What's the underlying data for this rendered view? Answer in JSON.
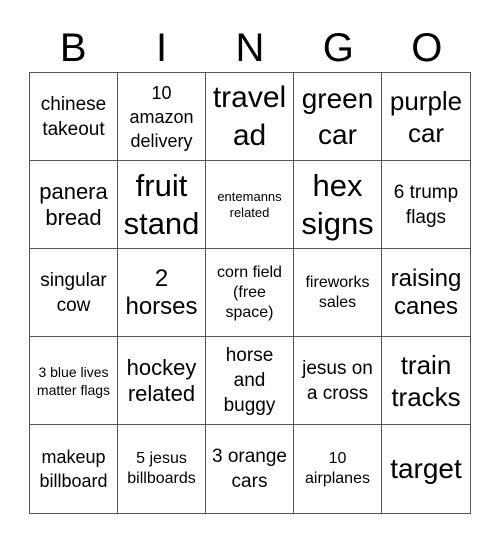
{
  "header": {
    "letters": [
      "B",
      "I",
      "N",
      "G",
      "O"
    ]
  },
  "board": {
    "rows": [
      [
        "chinese takeout",
        "10 amazon delivery",
        "travel ad",
        "green car",
        "purple car"
      ],
      [
        "panera bread",
        "fruit stand",
        "entemanns related",
        "hex signs",
        "6 trump flags"
      ],
      [
        "singular cow",
        "2 horses",
        "corn field (free space)",
        "fireworks sales",
        "raising canes"
      ],
      [
        "3 blue lives matter flags",
        "hockey related",
        "horse and buggy",
        "jesus on a cross",
        "train tracks"
      ],
      [
        "makeup billboard",
        "5 jesus billboards",
        "3 orange cars",
        "10 airplanes",
        "target"
      ]
    ],
    "free_space": "corn field (free space)"
  }
}
